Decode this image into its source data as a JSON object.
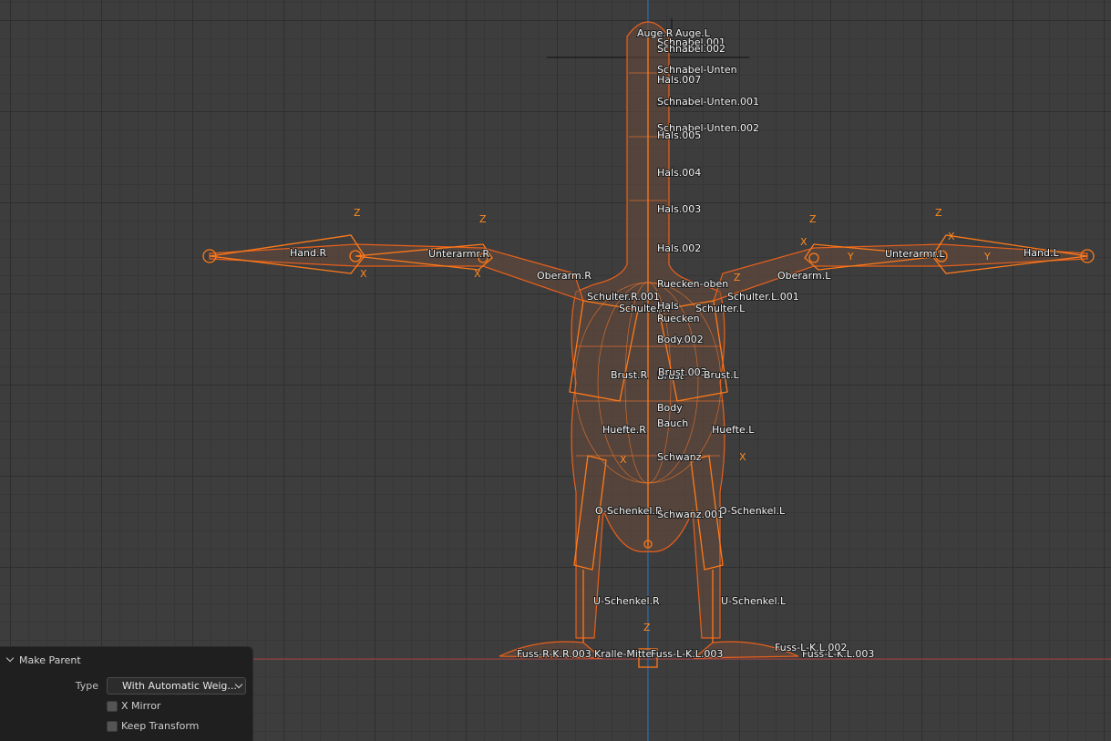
{
  "operator_panel": {
    "title": "Make Parent",
    "type_label": "Type",
    "type_value": "With Automatic Weig...",
    "x_mirror_label": "X Mirror",
    "keep_transform_label": "Keep Transform"
  },
  "colors": {
    "bone": "#ff7a1a",
    "mesh": "#e8601c",
    "viewport": "#3d3d3d",
    "x_axis_line": "#b04a4a",
    "z_axis_line": "#3a6fb0"
  },
  "bone_labels": {
    "auge_r": "Auge.R",
    "auge_l": "Auge.L",
    "schnabel_001": "Schnabel.001",
    "schnabel_002": "Schnabel.002",
    "schnabel_unten": "Schnabel-Unten",
    "hals_007": "Hals.007",
    "schnabel": "Schnabel",
    "schnabel_unten_001": "Schnabel-Unten.001",
    "schnabel_unten_002": "Schnabel-Unten.002",
    "hals_005": "Hals.005",
    "hals_004": "Hals.004",
    "hals_003": "Hals.003",
    "hals_002": "Hals.002",
    "hand_r": "Hand.R",
    "unterarm_r": "Unterarmr.R",
    "oberarm_r": "Oberarm.R",
    "hand_l": "Hand.L",
    "unterarm_l": "Unterarmr.L",
    "oberarm_l": "Oberarm.L",
    "ruecken_oben": "Ruecken-oben",
    "schulter_r_001": "Schulter.R.001",
    "schulter_l_001": "Schulter.L.001",
    "schulter_r": "Schulter.R",
    "schulter_l": "Schulter.L",
    "hals": "Hals",
    "ruecken": "Ruecken",
    "body_002": "Body.002",
    "brust_r": "Brust.R",
    "brust": "Brust",
    "brust_003": "Brust.003",
    "brust_l": "Brust.L",
    "body": "Body",
    "bauch": "Bauch",
    "huefte_r": "Huefte.R",
    "huefte_l": "Huefte.L",
    "schwanz": "Schwanz",
    "o_schenkel_r": "O-Schenkel.R",
    "o_schenkel_l": "O-Schenkel.L",
    "schwanz_001": "Schwanz.001",
    "u_schenkel_r": "U-Schenkel.R",
    "u_schenkel_l": "U-Schenkel.L",
    "fuss_r_k_r_003": "Fuss-R-K.R.003",
    "kralle_mitte": "Kralle-Mitte",
    "fuss_l_k_l_003": "Fuss-L-K.L.003",
    "fuss_l_002": "Fuss-L-K.L.002",
    "fuss_mid": "Fuss-L-K.L.003"
  },
  "axis_letters": {
    "x": "X",
    "y": "Y",
    "z": "Z"
  }
}
